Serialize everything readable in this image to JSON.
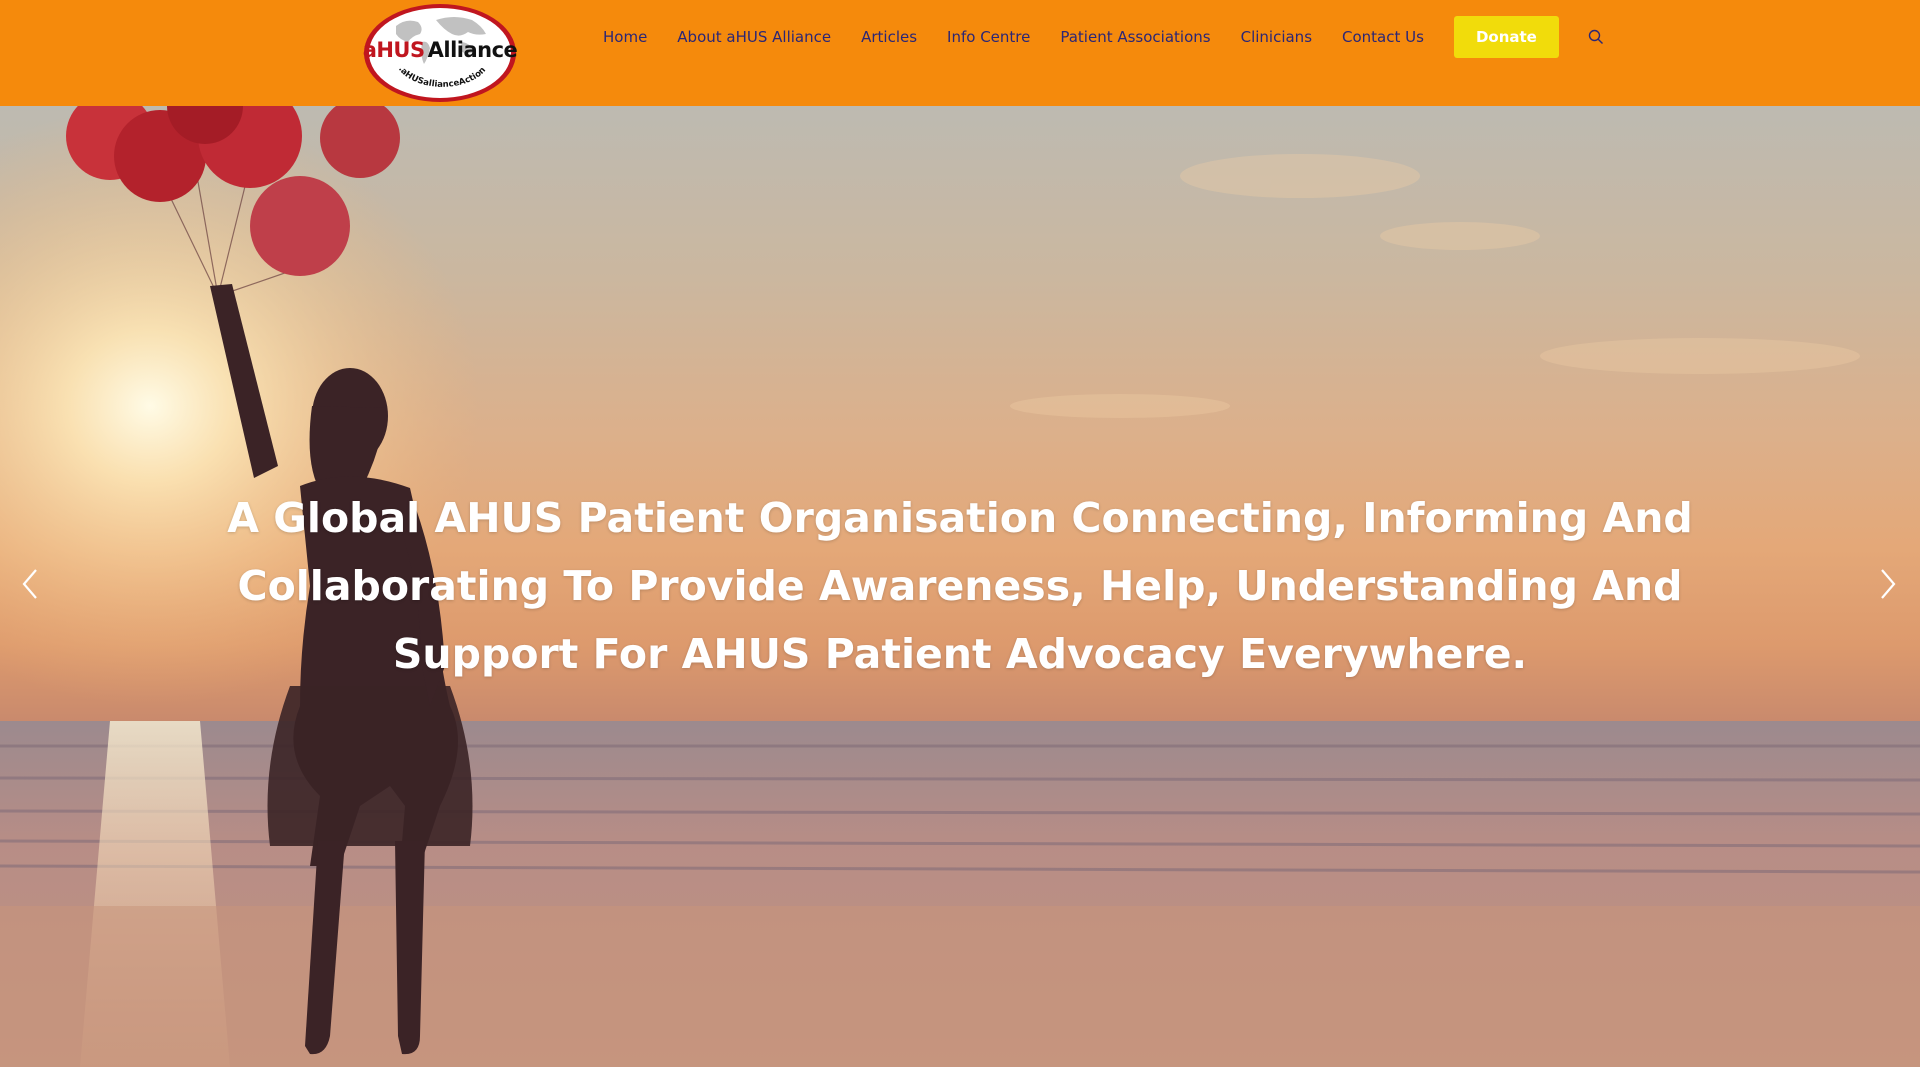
{
  "header": {
    "logo": {
      "title": "aHUS Alliance",
      "title_prefix": "aHUS",
      "title_suffix": "Alliance",
      "url_text": "www.aHUSallianceAction.org"
    },
    "nav": [
      {
        "label": "Home"
      },
      {
        "label": "About aHUS Alliance"
      },
      {
        "label": "Articles"
      },
      {
        "label": "Info Centre"
      },
      {
        "label": "Patient Associations"
      },
      {
        "label": "Clinicians"
      },
      {
        "label": "Contact Us"
      }
    ],
    "donate_label": "Donate",
    "search_icon": "search-icon"
  },
  "hero": {
    "headline": "A Global AHUS Patient Organisation Connecting, Informing And Collaborating To Provide Awareness, Help, Understanding And Support For AHUS Patient Advocacy Everywhere.",
    "prev_icon": "chevron-left-icon",
    "next_icon": "chevron-right-icon"
  },
  "colors": {
    "header_bg": "#f58a0c",
    "nav_text": "#2b2676",
    "donate_bg": "#f1dc0b",
    "logo_red": "#c0161f"
  }
}
